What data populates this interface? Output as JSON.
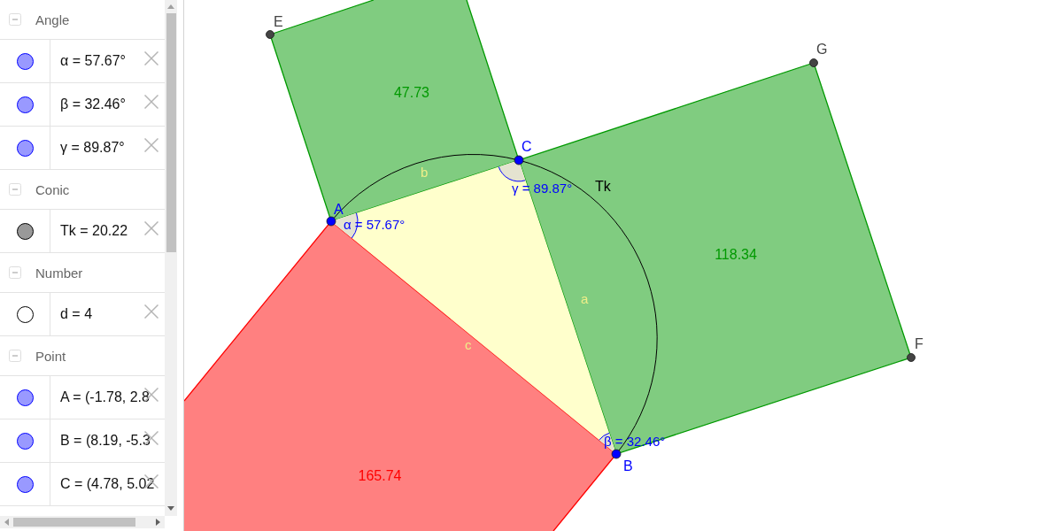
{
  "algebra_view": {
    "groups": [
      {
        "title": "Angle",
        "expanded": true,
        "items": [
          {
            "text": "α = 57.67°",
            "visible": true,
            "color": "#9999ff"
          },
          {
            "text": "β = 32.46°",
            "visible": true,
            "color": "#9999ff"
          },
          {
            "text": "γ = 89.87°",
            "visible": true,
            "color": "#9999ff"
          }
        ]
      },
      {
        "title": "Conic",
        "expanded": true,
        "items": [
          {
            "text": "Tk = 20.22",
            "visible": true,
            "color": "#999999"
          }
        ]
      },
      {
        "title": "Number",
        "expanded": true,
        "items": [
          {
            "text": "d = 4",
            "visible": false
          }
        ]
      },
      {
        "title": "Point",
        "expanded": true,
        "items": [
          {
            "text": "A = (-1.78, 2.8",
            "visible": true,
            "color": "#9999ff"
          },
          {
            "text": "B = (8.19, -5.3",
            "visible": true,
            "color": "#9999ff"
          },
          {
            "text": "C = (4.78, 5.02",
            "visible": true,
            "color": "#9999ff"
          }
        ]
      }
    ]
  },
  "graphics_view": {
    "squares": [
      {
        "area": "47.73",
        "color": "#009900"
      },
      {
        "area": "118.34",
        "color": "#009900"
      },
      {
        "area": "165.74",
        "color": "#ff0000"
      }
    ],
    "side_labels": [
      "a",
      "b",
      "c"
    ],
    "conic": {
      "label": "Tk"
    },
    "angles": [
      {
        "label": "α = 57.67°"
      },
      {
        "label": "β = 32.46°"
      },
      {
        "label": "γ = 89.87°"
      }
    ],
    "points": [
      {
        "label": "A",
        "color": "#0000ff"
      },
      {
        "label": "B",
        "color": "#0000ff"
      },
      {
        "label": "C",
        "color": "#0000ff"
      },
      {
        "label": "E",
        "color": "#444444"
      },
      {
        "label": "F",
        "color": "#444444"
      },
      {
        "label": "G",
        "color": "#444444"
      }
    ]
  }
}
